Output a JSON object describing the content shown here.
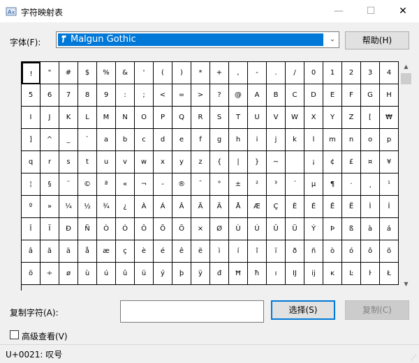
{
  "window": {
    "title": "字符映射表",
    "minimize": "—",
    "maximize": "☐",
    "close": "✕"
  },
  "font": {
    "label": "字体(F):",
    "selected": "Malgun Gothic",
    "icon": "opentype-font-icon"
  },
  "help_label": "帮助(H)",
  "grid": {
    "columns": 20,
    "selected_index": 0,
    "rows": [
      [
        "!",
        "\"",
        "#",
        "$",
        "%",
        "&",
        "'",
        "(",
        ")",
        "*",
        "+",
        ",",
        "-",
        ".",
        "/",
        "0",
        "1",
        "2",
        "3",
        "4"
      ],
      [
        "5",
        "6",
        "7",
        "8",
        "9",
        ":",
        ";",
        "<",
        "=",
        ">",
        "?",
        "@",
        "A",
        "B",
        "C",
        "D",
        "E",
        "F",
        "G",
        "H"
      ],
      [
        "I",
        "J",
        "K",
        "L",
        "M",
        "N",
        "O",
        "P",
        "Q",
        "R",
        "S",
        "T",
        "U",
        "V",
        "W",
        "X",
        "Y",
        "Z",
        "[",
        "₩"
      ],
      [
        "]",
        "^",
        "_",
        "`",
        "a",
        "b",
        "c",
        "d",
        "e",
        "f",
        "g",
        "h",
        "i",
        "j",
        "k",
        "l",
        "m",
        "n",
        "o",
        "p"
      ],
      [
        "q",
        "r",
        "s",
        "t",
        "u",
        "v",
        "w",
        "x",
        "y",
        "z",
        "{",
        "|",
        "}",
        "~",
        " ",
        "¡",
        "¢",
        "£",
        "¤",
        "¥"
      ],
      [
        "¦",
        "§",
        "¨",
        "©",
        "ª",
        "«",
        "¬",
        "-",
        "®",
        "¯",
        "°",
        "±",
        "²",
        "³",
        "´",
        "µ",
        "¶",
        "·",
        "¸",
        "¹"
      ],
      [
        "º",
        "»",
        "¼",
        "½",
        "¾",
        "¿",
        "À",
        "Á",
        "Â",
        "Ã",
        "Ä",
        "Å",
        "Æ",
        "Ç",
        "È",
        "É",
        "Ê",
        "Ë",
        "Ì",
        "Í"
      ],
      [
        "Î",
        "Ï",
        "Ð",
        "Ñ",
        "Ò",
        "Ó",
        "Ô",
        "Õ",
        "Ö",
        "×",
        "Ø",
        "Ù",
        "Ú",
        "Û",
        "Ü",
        "Ý",
        "Þ",
        "ß",
        "à",
        "á"
      ],
      [
        "â",
        "ã",
        "ä",
        "å",
        "æ",
        "ç",
        "è",
        "é",
        "ê",
        "ë",
        "ì",
        "í",
        "î",
        "ï",
        "ð",
        "ñ",
        "ò",
        "ó",
        "ô",
        "õ"
      ],
      [
        "ö",
        "÷",
        "ø",
        "ù",
        "ú",
        "û",
        "ü",
        "ý",
        "þ",
        "ÿ",
        "đ",
        "Ħ",
        "ħ",
        "ı",
        "Ĳ",
        "ĳ",
        "ĸ",
        "Ŀ",
        "ŀ",
        "Ł"
      ]
    ]
  },
  "scrollbar": {
    "up": "▲",
    "down": "▼"
  },
  "copy": {
    "label": "复制字符(A):",
    "value": "",
    "select_label": "选择(S)",
    "copy_label": "复制(C)"
  },
  "advanced_label": "高级查看(V)",
  "status": "U+0021: 叹号"
}
